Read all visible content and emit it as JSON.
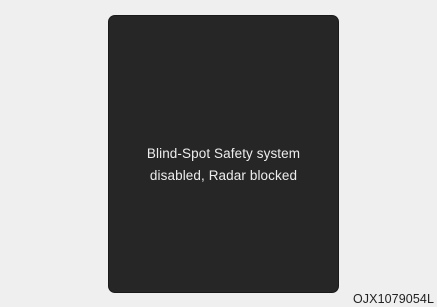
{
  "display": {
    "message_line1": "Blind-Spot Safety system",
    "message_line2": "disabled, Radar blocked",
    "background_color": "#262626",
    "text_color": "#ededed"
  },
  "figure": {
    "code": "OJX1079054L"
  }
}
